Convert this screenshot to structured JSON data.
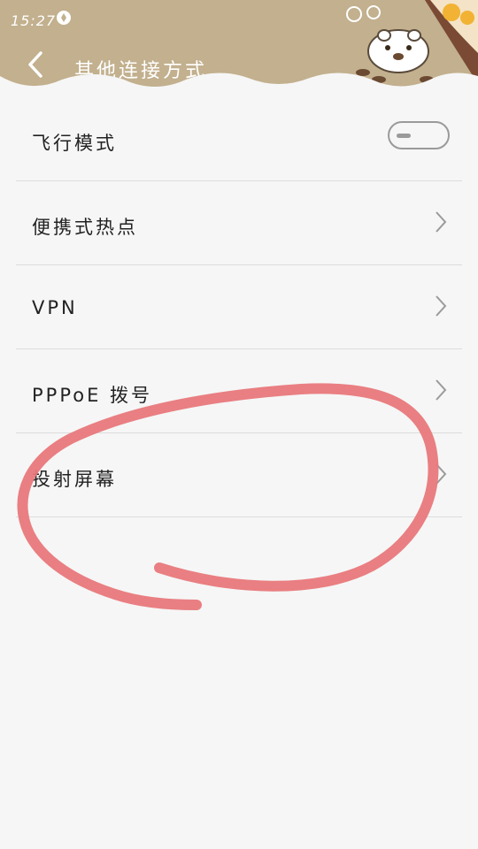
{
  "status": {
    "time": "15:27",
    "icon": "sync-icon"
  },
  "header": {
    "back_icon": "chevron-left-icon",
    "title": "其他连接方式",
    "colors": {
      "background": "#c2b08e",
      "title": "#ffffff"
    }
  },
  "settings": {
    "items": [
      {
        "label": "飞行模式",
        "control": "toggle",
        "enabled": false
      },
      {
        "label": "便携式热点",
        "control": "chevron-right-icon"
      },
      {
        "label": "VPN",
        "control": "chevron-right-icon"
      },
      {
        "label": "PPPoE 拨号",
        "control": "chevron-right-icon"
      },
      {
        "label": "投射屏幕",
        "control": "chevron-right-icon"
      }
    ]
  },
  "annotation": {
    "shape": "hand-drawn circle",
    "color": "#e8787b",
    "target": "投射屏幕"
  }
}
